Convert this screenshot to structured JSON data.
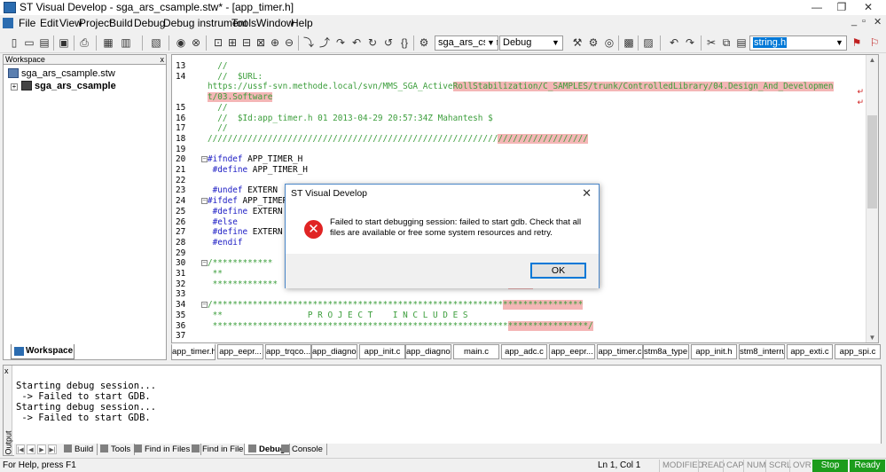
{
  "window": {
    "title": "ST Visual Develop - sga_ars_csample.stw* - [app_timer.h]",
    "minimize_glyph": "—",
    "restore_glyph": "❐",
    "close_glyph": "✕"
  },
  "menu": {
    "items": [
      "File",
      "Edit",
      "View",
      "Project",
      "Build",
      "Debug",
      "Debug instrument",
      "Tools",
      "Window",
      "Help"
    ],
    "mdi_controls": [
      "_",
      "▫",
      "✕"
    ]
  },
  "toolbar": {
    "project_combo": "sga_ars_csampl",
    "config_combo": "Debug",
    "search_combo": "string.h"
  },
  "workspace": {
    "header": "Workspace",
    "close_glyph": "x",
    "tree": {
      "root": "sga_ars_csample.stw",
      "expand_glyph": "+",
      "child": "sga_ars_csample"
    },
    "tab_label": "Workspace"
  },
  "editor": {
    "lines": [
      {
        "n": "13",
        "segs": [
          {
            "t": "  //",
            "c": "cm"
          }
        ]
      },
      {
        "n": "14",
        "segs": [
          {
            "t": "  //  $URL:",
            "c": "cm"
          }
        ]
      },
      {
        "n": "",
        "segs": [
          {
            "t": "https://ussf-svn.methode.local/svn/MMS_SGA_Active",
            "c": "cm"
          },
          {
            "t": "RollStabilization/C_SAMPLES/trunk/ControlledLibrary/04.Design_And_Developmen",
            "c": "cm hl"
          }
        ]
      },
      {
        "n": "",
        "segs": [
          {
            "t": "t/03.Software",
            "c": "cm hl"
          }
        ]
      },
      {
        "n": "15",
        "segs": [
          {
            "t": "  //",
            "c": "cm"
          }
        ]
      },
      {
        "n": "16",
        "segs": [
          {
            "t": "  //  $Id:app_timer.h 01 2013-04-29 20:57:34Z Mahantesh $",
            "c": "cm"
          }
        ]
      },
      {
        "n": "17",
        "segs": [
          {
            "t": "  //",
            "c": "cm"
          }
        ]
      },
      {
        "n": "18",
        "segs": [
          {
            "t": "//////////////////////////////////////////////////////////",
            "c": "cm"
          },
          {
            "t": "//////////////////",
            "c": "cm hl"
          }
        ]
      },
      {
        "n": "19",
        "segs": []
      },
      {
        "n": "20",
        "fold": "−",
        "segs": [
          {
            "t": "#ifndef",
            "c": "pp"
          },
          {
            "t": " APP_TIMER_H",
            "c": ""
          }
        ]
      },
      {
        "n": "21",
        "segs": [
          {
            "t": " #define",
            "c": "pp"
          },
          {
            "t": " APP_TIMER_H",
            "c": ""
          }
        ]
      },
      {
        "n": "22",
        "segs": []
      },
      {
        "n": "23",
        "segs": [
          {
            "t": " #undef",
            "c": "pp"
          },
          {
            "t": " EXTERN",
            "c": ""
          }
        ]
      },
      {
        "n": "24",
        "fold": "−",
        "segs": [
          {
            "t": "#ifdef",
            "c": "pp"
          },
          {
            "t": " APP_TIMER",
            "c": ""
          }
        ]
      },
      {
        "n": "25",
        "segs": [
          {
            "t": " #define",
            "c": "pp"
          },
          {
            "t": " EXTERN",
            "c": ""
          }
        ]
      },
      {
        "n": "26",
        "segs": [
          {
            "t": " #else",
            "c": "pp"
          }
        ]
      },
      {
        "n": "27",
        "segs": [
          {
            "t": " #define",
            "c": "pp"
          },
          {
            "t": " EXTERN e",
            "c": ""
          }
        ]
      },
      {
        "n": "28",
        "segs": [
          {
            "t": " #endif",
            "c": "pp"
          }
        ]
      },
      {
        "n": "29",
        "segs": []
      },
      {
        "n": "30",
        "fold": "−",
        "segs": [
          {
            "t": "/************",
            "c": "cm"
          },
          {
            "t": "                                               ",
            "c": ""
          },
          {
            "t": "****",
            "c": "cm hl"
          }
        ]
      },
      {
        "n": "31",
        "segs": [
          {
            "t": " **",
            "c": "cm"
          }
        ]
      },
      {
        "n": "32",
        "segs": [
          {
            "t": " *************",
            "c": "cm"
          },
          {
            "t": "                                              ",
            "c": ""
          },
          {
            "t": "****/",
            "c": "cm hl"
          }
        ]
      },
      {
        "n": "33",
        "segs": []
      },
      {
        "n": "34",
        "fold": "−",
        "segs": [
          {
            "t": "/**********************************************************",
            "c": "cm"
          },
          {
            "t": "****************",
            "c": "cm hl"
          }
        ]
      },
      {
        "n": "35",
        "segs": [
          {
            "t": " **                 P R O J E C T    I N C L U D E S",
            "c": "cm"
          }
        ]
      },
      {
        "n": "36",
        "segs": [
          {
            "t": " ***********************************************************",
            "c": "cm"
          },
          {
            "t": "****************/",
            "c": "cm hl"
          }
        ]
      },
      {
        "n": "37",
        "segs": []
      }
    ],
    "tabs": [
      "app_timer.h",
      "app_eepr...",
      "app_trqco...",
      "app_diagno...",
      "app_init.c",
      "app_diagno...",
      "main.c",
      "app_adc.c",
      "app_eepr...",
      "app_timer.c",
      "stm8a_type.h",
      "app_init.h",
      "stm8_interru...",
      "app_exti.c",
      "app_spi.c"
    ],
    "active_tab": 0
  },
  "dialog": {
    "title": "ST Visual Develop",
    "close_glyph": "✕",
    "message": "Failed to start debugging session: failed to start gdb. Check that all files are available or free some system resources and retry.",
    "ok_label": "OK",
    "error_glyph": "✕"
  },
  "output": {
    "side_label": "Output",
    "close_glyph": "x",
    "lines": [
      "Starting debug session...",
      " -> Failed to start GDB.",
      "Starting debug session...",
      " -> Failed to start GDB."
    ],
    "tabs": [
      "Build",
      "Tools",
      "Find in Files 1",
      "Find in Files 2",
      "Debug",
      "Console"
    ],
    "active_tab": 4
  },
  "status": {
    "help": "For Help, press F1",
    "position": "Ln 1, Col 1",
    "indicators": [
      "MODIFIED",
      "READ",
      "CAP",
      "NUM",
      "SCRL",
      "OVR"
    ],
    "stop": "Stop",
    "ready": "Ready"
  },
  "colors": {
    "comment": "#3c9e3c",
    "preprocessor": "#1c1cc4",
    "highlight": "#f4b6b6",
    "status_green": "#1c9c1c",
    "selection": "#0078d7"
  }
}
